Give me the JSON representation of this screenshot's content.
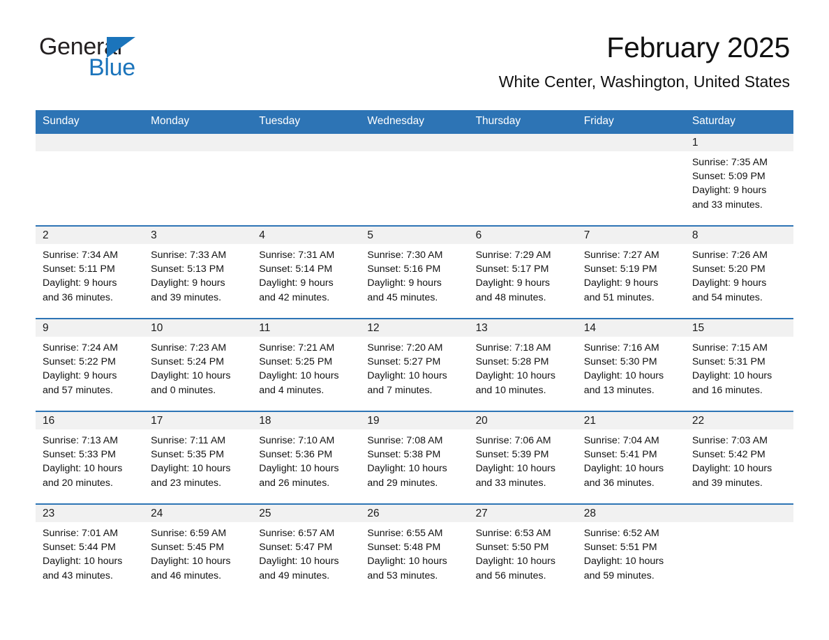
{
  "logo": {
    "word_one": "General",
    "word_two": "Blue",
    "triangle_color": "#1b74bb",
    "blue_color": "#1b74bb"
  },
  "header": {
    "month_title": "February 2025",
    "location": "White Center, Washington, United States"
  },
  "theme": {
    "header_blue": "#2d74b5",
    "daynum_band_gray": "#f1f1f1",
    "row_rule_blue": "#2d74b5"
  },
  "weekday_headers": [
    "Sunday",
    "Monday",
    "Tuesday",
    "Wednesday",
    "Thursday",
    "Friday",
    "Saturday"
  ],
  "weeks": [
    [
      {
        "day": "",
        "sunrise": "",
        "sunset": "",
        "daylight_line1": "",
        "daylight_line2": ""
      },
      {
        "day": "",
        "sunrise": "",
        "sunset": "",
        "daylight_line1": "",
        "daylight_line2": ""
      },
      {
        "day": "",
        "sunrise": "",
        "sunset": "",
        "daylight_line1": "",
        "daylight_line2": ""
      },
      {
        "day": "",
        "sunrise": "",
        "sunset": "",
        "daylight_line1": "",
        "daylight_line2": ""
      },
      {
        "day": "",
        "sunrise": "",
        "sunset": "",
        "daylight_line1": "",
        "daylight_line2": ""
      },
      {
        "day": "",
        "sunrise": "",
        "sunset": "",
        "daylight_line1": "",
        "daylight_line2": ""
      },
      {
        "day": "1",
        "sunrise": "Sunrise: 7:35 AM",
        "sunset": "Sunset: 5:09 PM",
        "daylight_line1": "Daylight: 9 hours",
        "daylight_line2": "and 33 minutes."
      }
    ],
    [
      {
        "day": "2",
        "sunrise": "Sunrise: 7:34 AM",
        "sunset": "Sunset: 5:11 PM",
        "daylight_line1": "Daylight: 9 hours",
        "daylight_line2": "and 36 minutes."
      },
      {
        "day": "3",
        "sunrise": "Sunrise: 7:33 AM",
        "sunset": "Sunset: 5:13 PM",
        "daylight_line1": "Daylight: 9 hours",
        "daylight_line2": "and 39 minutes."
      },
      {
        "day": "4",
        "sunrise": "Sunrise: 7:31 AM",
        "sunset": "Sunset: 5:14 PM",
        "daylight_line1": "Daylight: 9 hours",
        "daylight_line2": "and 42 minutes."
      },
      {
        "day": "5",
        "sunrise": "Sunrise: 7:30 AM",
        "sunset": "Sunset: 5:16 PM",
        "daylight_line1": "Daylight: 9 hours",
        "daylight_line2": "and 45 minutes."
      },
      {
        "day": "6",
        "sunrise": "Sunrise: 7:29 AM",
        "sunset": "Sunset: 5:17 PM",
        "daylight_line1": "Daylight: 9 hours",
        "daylight_line2": "and 48 minutes."
      },
      {
        "day": "7",
        "sunrise": "Sunrise: 7:27 AM",
        "sunset": "Sunset: 5:19 PM",
        "daylight_line1": "Daylight: 9 hours",
        "daylight_line2": "and 51 minutes."
      },
      {
        "day": "8",
        "sunrise": "Sunrise: 7:26 AM",
        "sunset": "Sunset: 5:20 PM",
        "daylight_line1": "Daylight: 9 hours",
        "daylight_line2": "and 54 minutes."
      }
    ],
    [
      {
        "day": "9",
        "sunrise": "Sunrise: 7:24 AM",
        "sunset": "Sunset: 5:22 PM",
        "daylight_line1": "Daylight: 9 hours",
        "daylight_line2": "and 57 minutes."
      },
      {
        "day": "10",
        "sunrise": "Sunrise: 7:23 AM",
        "sunset": "Sunset: 5:24 PM",
        "daylight_line1": "Daylight: 10 hours",
        "daylight_line2": "and 0 minutes."
      },
      {
        "day": "11",
        "sunrise": "Sunrise: 7:21 AM",
        "sunset": "Sunset: 5:25 PM",
        "daylight_line1": "Daylight: 10 hours",
        "daylight_line2": "and 4 minutes."
      },
      {
        "day": "12",
        "sunrise": "Sunrise: 7:20 AM",
        "sunset": "Sunset: 5:27 PM",
        "daylight_line1": "Daylight: 10 hours",
        "daylight_line2": "and 7 minutes."
      },
      {
        "day": "13",
        "sunrise": "Sunrise: 7:18 AM",
        "sunset": "Sunset: 5:28 PM",
        "daylight_line1": "Daylight: 10 hours",
        "daylight_line2": "and 10 minutes."
      },
      {
        "day": "14",
        "sunrise": "Sunrise: 7:16 AM",
        "sunset": "Sunset: 5:30 PM",
        "daylight_line1": "Daylight: 10 hours",
        "daylight_line2": "and 13 minutes."
      },
      {
        "day": "15",
        "sunrise": "Sunrise: 7:15 AM",
        "sunset": "Sunset: 5:31 PM",
        "daylight_line1": "Daylight: 10 hours",
        "daylight_line2": "and 16 minutes."
      }
    ],
    [
      {
        "day": "16",
        "sunrise": "Sunrise: 7:13 AM",
        "sunset": "Sunset: 5:33 PM",
        "daylight_line1": "Daylight: 10 hours",
        "daylight_line2": "and 20 minutes."
      },
      {
        "day": "17",
        "sunrise": "Sunrise: 7:11 AM",
        "sunset": "Sunset: 5:35 PM",
        "daylight_line1": "Daylight: 10 hours",
        "daylight_line2": "and 23 minutes."
      },
      {
        "day": "18",
        "sunrise": "Sunrise: 7:10 AM",
        "sunset": "Sunset: 5:36 PM",
        "daylight_line1": "Daylight: 10 hours",
        "daylight_line2": "and 26 minutes."
      },
      {
        "day": "19",
        "sunrise": "Sunrise: 7:08 AM",
        "sunset": "Sunset: 5:38 PM",
        "daylight_line1": "Daylight: 10 hours",
        "daylight_line2": "and 29 minutes."
      },
      {
        "day": "20",
        "sunrise": "Sunrise: 7:06 AM",
        "sunset": "Sunset: 5:39 PM",
        "daylight_line1": "Daylight: 10 hours",
        "daylight_line2": "and 33 minutes."
      },
      {
        "day": "21",
        "sunrise": "Sunrise: 7:04 AM",
        "sunset": "Sunset: 5:41 PM",
        "daylight_line1": "Daylight: 10 hours",
        "daylight_line2": "and 36 minutes."
      },
      {
        "day": "22",
        "sunrise": "Sunrise: 7:03 AM",
        "sunset": "Sunset: 5:42 PM",
        "daylight_line1": "Daylight: 10 hours",
        "daylight_line2": "and 39 minutes."
      }
    ],
    [
      {
        "day": "23",
        "sunrise": "Sunrise: 7:01 AM",
        "sunset": "Sunset: 5:44 PM",
        "daylight_line1": "Daylight: 10 hours",
        "daylight_line2": "and 43 minutes."
      },
      {
        "day": "24",
        "sunrise": "Sunrise: 6:59 AM",
        "sunset": "Sunset: 5:45 PM",
        "daylight_line1": "Daylight: 10 hours",
        "daylight_line2": "and 46 minutes."
      },
      {
        "day": "25",
        "sunrise": "Sunrise: 6:57 AM",
        "sunset": "Sunset: 5:47 PM",
        "daylight_line1": "Daylight: 10 hours",
        "daylight_line2": "and 49 minutes."
      },
      {
        "day": "26",
        "sunrise": "Sunrise: 6:55 AM",
        "sunset": "Sunset: 5:48 PM",
        "daylight_line1": "Daylight: 10 hours",
        "daylight_line2": "and 53 minutes."
      },
      {
        "day": "27",
        "sunrise": "Sunrise: 6:53 AM",
        "sunset": "Sunset: 5:50 PM",
        "daylight_line1": "Daylight: 10 hours",
        "daylight_line2": "and 56 minutes."
      },
      {
        "day": "28",
        "sunrise": "Sunrise: 6:52 AM",
        "sunset": "Sunset: 5:51 PM",
        "daylight_line1": "Daylight: 10 hours",
        "daylight_line2": "and 59 minutes."
      },
      {
        "day": "",
        "sunrise": "",
        "sunset": "",
        "daylight_line1": "",
        "daylight_line2": ""
      }
    ]
  ]
}
